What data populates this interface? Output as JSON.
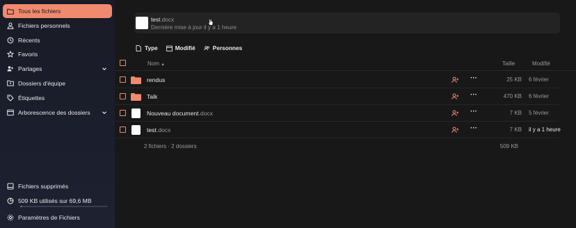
{
  "sidebar": {
    "items": [
      {
        "label": "Tous les fichiers",
        "icon": "folder-icon",
        "active": true
      },
      {
        "label": "Fichiers personnels",
        "icon": "user-icon"
      },
      {
        "label": "Récents",
        "icon": "history-icon"
      },
      {
        "label": "Favoris",
        "icon": "star-icon"
      },
      {
        "label": "Partages",
        "icon": "share-icon",
        "expandable": true
      },
      {
        "label": "Dossiers d'équipe",
        "icon": "team-folder-icon"
      },
      {
        "label": "Étiquettes",
        "icon": "tag-icon"
      },
      {
        "label": "Arborescence des dossiers",
        "icon": "folder-tree-icon",
        "expandable": true
      }
    ],
    "bottom": {
      "trash_label": "Fichiers supprimés",
      "quota_label": "509 KB utilisés sur 69,6 MB",
      "quota_fraction": 0.007,
      "settings_label": "Paramètres de Fichiers"
    }
  },
  "recent": {
    "name": "test",
    "ext": ".docx",
    "subtitle": "Dernière mise à jour il y a 1 heure"
  },
  "filters": [
    {
      "label": "Type",
      "icon": "file-icon"
    },
    {
      "label": "Modifié",
      "icon": "calendar-icon"
    },
    {
      "label": "Personnes",
      "icon": "people-icon"
    }
  ],
  "table": {
    "headers": {
      "name": "Nom",
      "size": "Taille",
      "modified": "Modifié"
    },
    "rows": [
      {
        "name": "rendus",
        "ext": "",
        "type": "folder",
        "size": "25 KB",
        "modified": "6 février"
      },
      {
        "name": "Talk",
        "ext": "",
        "type": "folder",
        "size": "470 KB",
        "modified": "6 février"
      },
      {
        "name": "Nouveau document",
        "ext": ".docx",
        "type": "doc",
        "size": "7 KB",
        "modified": "5 février"
      },
      {
        "name": "test",
        "ext": ".docx",
        "type": "doc",
        "size": "7 KB",
        "modified": "il y a 1 heure"
      }
    ],
    "summary": "2 fichiers · 2 dossiers",
    "summary_size": "509 KB"
  },
  "colors": {
    "accent": "#f08a6f",
    "background": "#181818",
    "sidebar": "#1b1e2c"
  }
}
